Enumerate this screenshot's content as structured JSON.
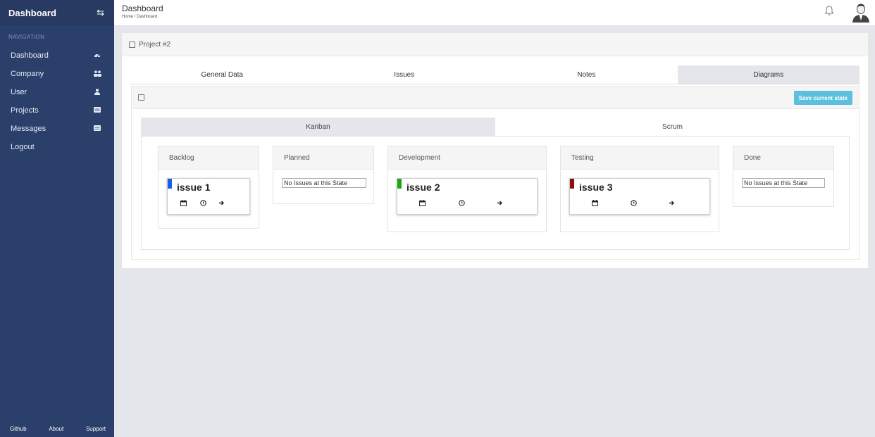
{
  "sidebar": {
    "title": "Dashboard",
    "section": "NAVIGATION",
    "items": [
      {
        "label": "Dashboard",
        "icon": "dashboard-icon"
      },
      {
        "label": "Company",
        "icon": "users-icon"
      },
      {
        "label": "User",
        "icon": "user-icon"
      },
      {
        "label": "Projects",
        "icon": "list-icon"
      },
      {
        "label": "Messages",
        "icon": "list-icon"
      },
      {
        "label": "Logout",
        "icon": ""
      }
    ],
    "footer": [
      "Github",
      "About",
      "Support"
    ]
  },
  "topbar": {
    "title": "Dashboard",
    "breadcrumb": "Home / Dashboard"
  },
  "panel": {
    "title": "Project #2",
    "tabs": [
      "General Data",
      "Issues",
      "Notes",
      "Diagrams"
    ],
    "active_tab": "Diagrams",
    "save_label": "Save current state",
    "board_tabs": [
      "Kanban",
      "Scrum"
    ],
    "active_board_tab": "Kanban"
  },
  "columns": [
    {
      "name": "Backlog"
    },
    {
      "name": "Planned",
      "empty": "No Issues at this State"
    },
    {
      "name": "Development"
    },
    {
      "name": "Testing"
    },
    {
      "name": "Done",
      "empty": "No Issues at this State"
    }
  ],
  "issues": [
    {
      "title": "issue 1",
      "state": "Backlog",
      "color": "#1a5fe0"
    },
    {
      "title": "issue 2",
      "state": "Development",
      "color": "#18a81a"
    },
    {
      "title": "issue 3",
      "state": "Testing",
      "color": "#8b0f0f"
    }
  ],
  "colors": {
    "sidebar": "#2b3f6b",
    "save_button": "#5bc0de",
    "active_tab": "#e4e6eb"
  }
}
